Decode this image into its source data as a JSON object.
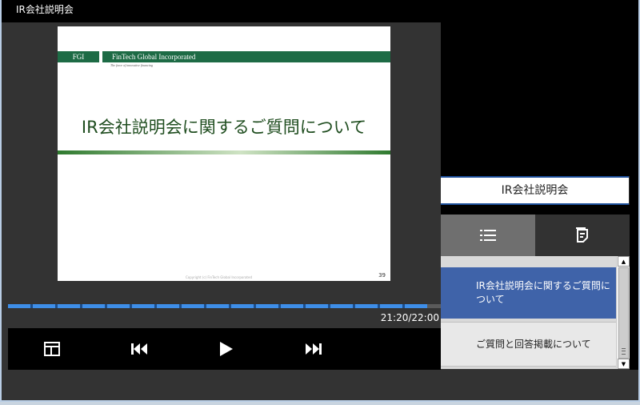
{
  "window": {
    "title": "IR会社説明会"
  },
  "slide": {
    "fgi": "FGI",
    "company": "FinTech Global Incorporated",
    "tagline": "The force of innovative financing",
    "title": "IR会社説明会に関するご質問について",
    "footer": "Copyright (c) FinTech Global Incorporated",
    "page_number": "39"
  },
  "player": {
    "progress_percent": 96.8,
    "timecode": "21:20/22:00",
    "buttons": {
      "layout": "layout-icon",
      "previous": "skip-previous-icon",
      "play": "play-icon",
      "next": "skip-next-icon"
    }
  },
  "side_panel": {
    "session_title": "IR会社説明会",
    "tabs": [
      {
        "icon": "list-icon",
        "active": true
      },
      {
        "icon": "notes-icon",
        "active": false
      }
    ],
    "chapters": [
      {
        "label": "IR会社説明会に関するご質問について",
        "active": true
      },
      {
        "label": "ご質問と回答掲載について",
        "active": false
      }
    ]
  },
  "colors": {
    "accent": "#3f63a9",
    "progress": "#3e8ee8",
    "slide_green": "#1d6b45"
  }
}
